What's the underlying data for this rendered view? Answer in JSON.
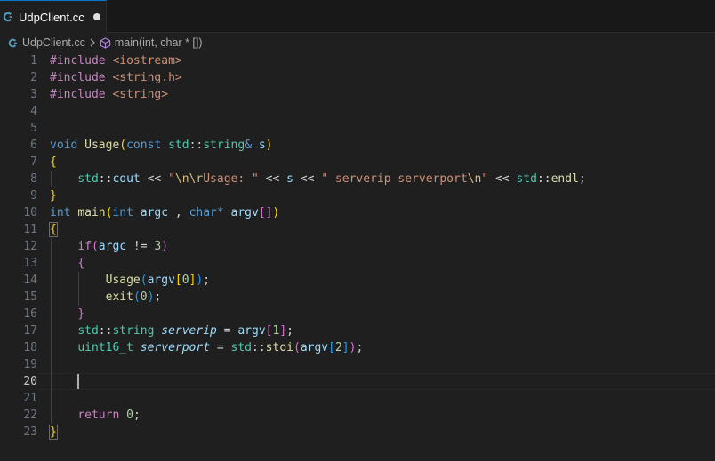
{
  "tab": {
    "filename": "UdpClient.cc",
    "accent": "#0078d4",
    "icon": "cpp-file-icon"
  },
  "breadcrumb": {
    "file": "UdpClient.cc",
    "symbol": "main(int, char * [])",
    "symbol_icon": "cube-icon"
  },
  "editor": {
    "active_line": "20",
    "line_numbers": [
      "1",
      "2",
      "3",
      "4",
      "5",
      "6",
      "7",
      "8",
      "9",
      "10",
      "11",
      "12",
      "13",
      "14",
      "15",
      "16",
      "17",
      "18",
      "19",
      "20",
      "21",
      "22",
      "23"
    ],
    "code": {
      "l1": {
        "kw": "#include",
        "sp": " ",
        "path": "<iostream>"
      },
      "l2": {
        "kw": "#include",
        "sp": " ",
        "path": "<string.h>"
      },
      "l3": {
        "kw": "#include",
        "sp": " ",
        "path": "<string>"
      },
      "l6": {
        "t1": "void",
        "t2": " ",
        "t3": "Usage",
        "t4": "(",
        "t5": "const",
        "t6": " ",
        "t7": "std",
        "t8": "::",
        "t9": "string",
        "t10": "&",
        "t11": " ",
        "t12": "s",
        "t13": ")"
      },
      "l7": {
        "t1": "{"
      },
      "l8": {
        "t0": "    ",
        "t1": "std",
        "t2": "::",
        "t3": "cout",
        "t4": " << ",
        "t5": "\"",
        "t6": "\\n\\r",
        "t7": "Usage: \"",
        "t8": " << ",
        "t9": "s",
        "t10": " << ",
        "t11": "\" serverip serverport",
        "t12": "\\n",
        "t13": "\"",
        "t14": " << ",
        "t15": "std",
        "t16": "::",
        "t17": "endl",
        "t18": ";"
      },
      "l9": {
        "t1": "}"
      },
      "l10": {
        "t1": "int",
        "t2": " ",
        "t3": "main",
        "t4": "(",
        "t5": "int",
        "t6": " ",
        "t7": "argc",
        "t8": " , ",
        "t9": "char",
        "t10": "*",
        "t11": " ",
        "t12": "argv",
        "t13": "[]",
        "t14": ")"
      },
      "l11": {
        "t1": "{"
      },
      "l12": {
        "t0": "    ",
        "t1": "if",
        "t2": "(",
        "t3": "argc",
        "t4": " != ",
        "t5": "3",
        "t6": ")"
      },
      "l13": {
        "t0": "    ",
        "t1": "{"
      },
      "l14": {
        "t0": "        ",
        "t1": "Usage",
        "t2": "(",
        "t3": "argv",
        "t4": "[",
        "t5": "0",
        "t6": "]",
        "t7": ")",
        "t8": ";"
      },
      "l15": {
        "t0": "        ",
        "t1": "exit",
        "t2": "(",
        "t3": "0",
        "t4": ")",
        "t5": ";"
      },
      "l16": {
        "t0": "    ",
        "t1": "}"
      },
      "l17": {
        "t0": "    ",
        "t1": "std",
        "t2": "::",
        "t3": "string",
        "t4": " ",
        "t5": "serverip",
        "t6": " = ",
        "t7": "argv",
        "t8": "[",
        "t9": "1",
        "t10": "]",
        "t11": ";"
      },
      "l18": {
        "t0": "    ",
        "t1": "uint16_t",
        "t2": " ",
        "t3": "serverport",
        "t4": " = ",
        "t5": "std",
        "t6": "::",
        "t7": "stoi",
        "t8": "(",
        "t9": "argv",
        "t10": "[",
        "t11": "2",
        "t12": "]",
        "t13": ")",
        "t14": ";"
      },
      "l22": {
        "t0": "    ",
        "t1": "return",
        "t2": " ",
        "t3": "0",
        "t4": ";"
      },
      "l23": {
        "t1": "}"
      }
    }
  },
  "colors": {
    "background": "#1f1f1f",
    "tabbar": "#181818",
    "keyword": "#569cd6",
    "preprocessor": "#c586c0",
    "function": "#dcdcaa",
    "type": "#4ec9b0",
    "variable": "#9cdcfe",
    "string": "#ce9178",
    "number": "#b5cea8"
  }
}
